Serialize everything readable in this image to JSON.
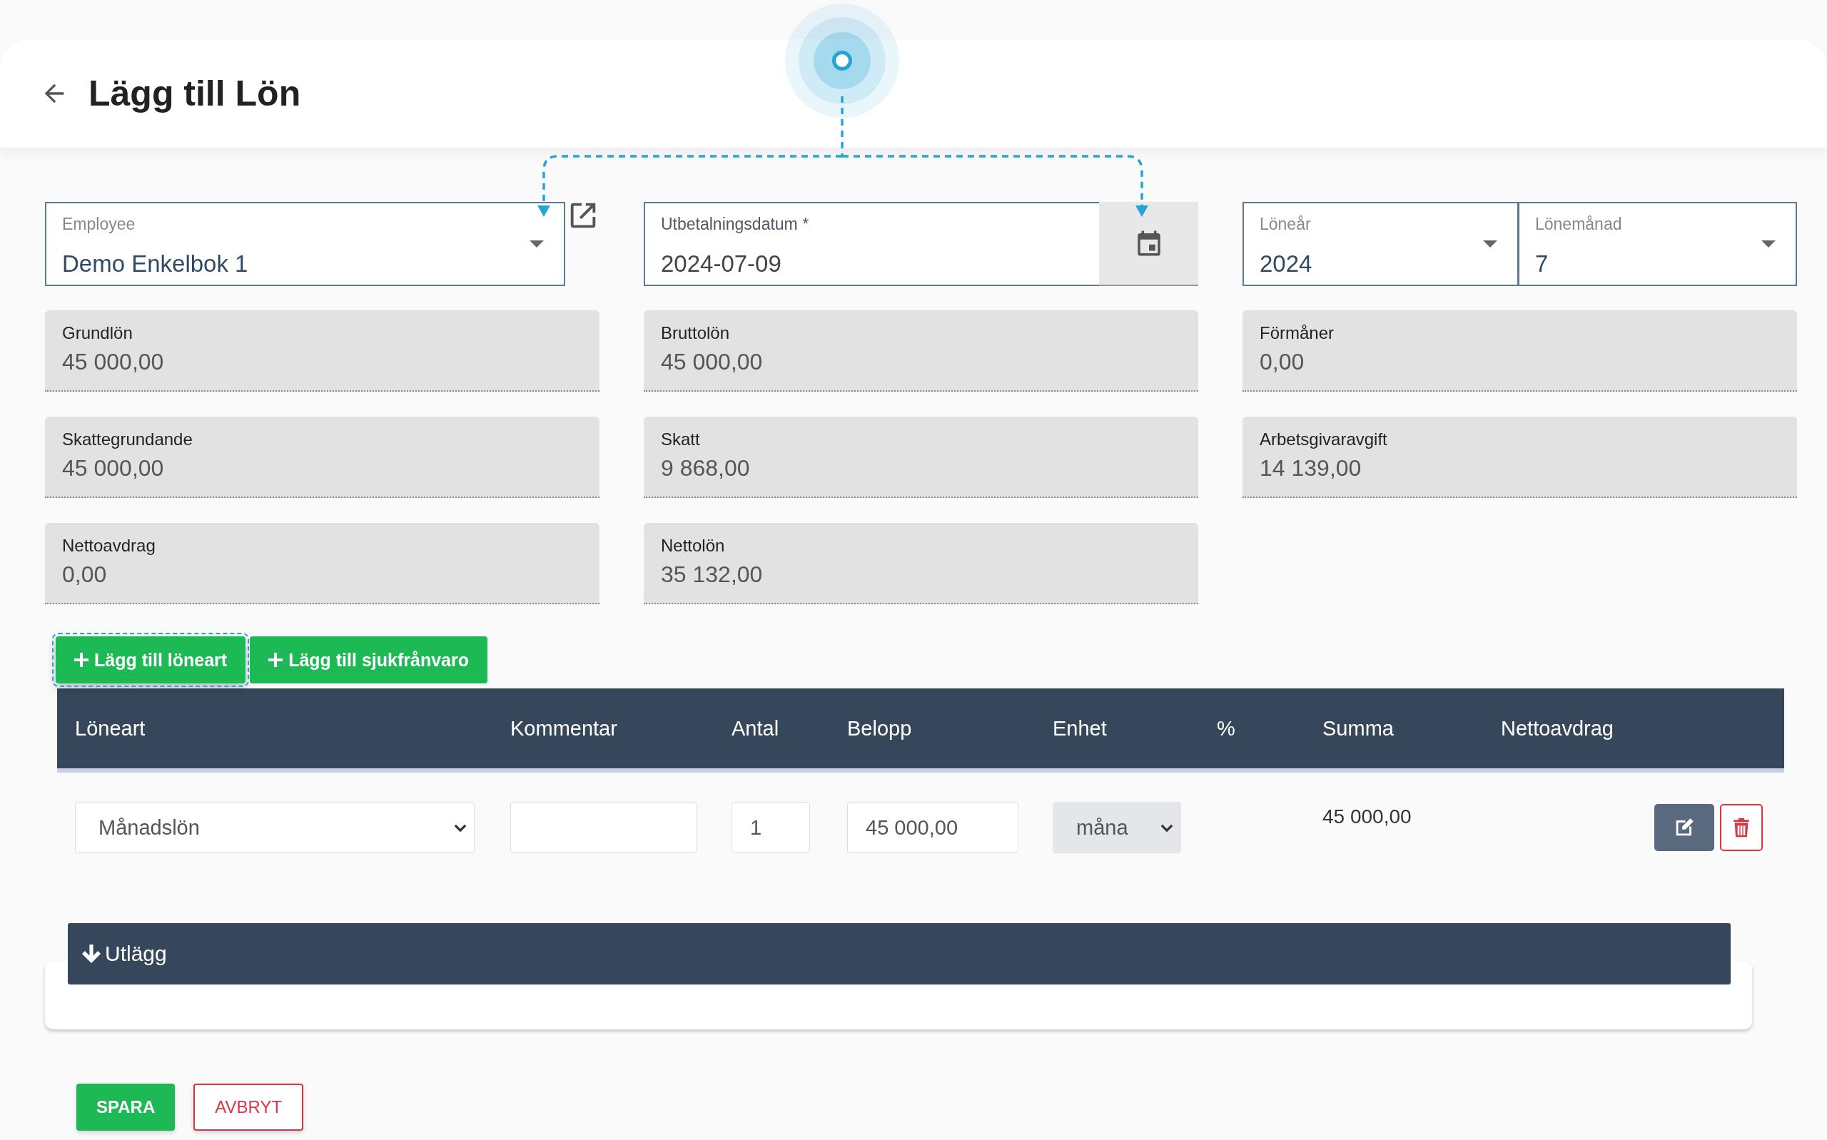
{
  "header": {
    "title": "Lägg till Lön"
  },
  "form": {
    "employee": {
      "label": "Employee",
      "value": "Demo Enkelbok 1"
    },
    "payment_date": {
      "label": "Utbetalningsdatum *",
      "value": "2024-07-09"
    },
    "salary_year": {
      "label": "Löneår",
      "value": "2024"
    },
    "salary_month": {
      "label": "Lönemånad",
      "value": "7"
    }
  },
  "summary": [
    {
      "label": "Grundlön",
      "value": "45 000,00"
    },
    {
      "label": "Bruttolön",
      "value": "45 000,00"
    },
    {
      "label": "Förmåner",
      "value": "0,00"
    },
    {
      "label": "Skattegrundande",
      "value": "45 000,00"
    },
    {
      "label": "Skatt",
      "value": "9 868,00"
    },
    {
      "label": "Arbetsgivaravgift",
      "value": "14 139,00"
    },
    {
      "label": "Nettoavdrag",
      "value": "0,00"
    },
    {
      "label": "Nettolön",
      "value": "35 132,00"
    }
  ],
  "actions": [
    {
      "label": "Lägg till löneart",
      "focused": true
    },
    {
      "label": "Lägg till sjukfrånvaro",
      "focused": false
    }
  ],
  "table": {
    "columns": [
      "Löneart",
      "Kommentar",
      "Antal",
      "Belopp",
      "Enhet",
      "%",
      "Summa",
      "Nettoavdrag"
    ],
    "rows": [
      {
        "wage_type": "Månadslön",
        "quantity": "1",
        "amount": "45 000,00",
        "unit": "måna",
        "sum": "45 000,00"
      }
    ]
  },
  "expenses": {
    "title": "Utlägg"
  },
  "footer_buttons": [
    {
      "label": "SPARA",
      "kind": "primary"
    },
    {
      "label": "AVBRYT",
      "kind": "danger"
    }
  ]
}
